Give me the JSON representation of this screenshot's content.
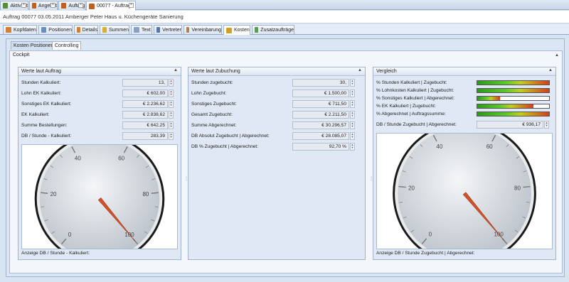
{
  "doc_tabs": [
    {
      "label": "Aktivität",
      "color": "#5a8a3c"
    },
    {
      "label": "Angebot",
      "color": "#c06020"
    },
    {
      "label": "Auftrag",
      "color": "#c06020"
    },
    {
      "label": "00077 - Auftrag",
      "color": "#c06020"
    }
  ],
  "header": {
    "title": "Auftrag 00077  03.05.2011  Amberger Peter Haus u. Küchengeräte  Sanierung"
  },
  "main_tabs": [
    {
      "label": "Kopfdaten"
    },
    {
      "label": "Positionen"
    },
    {
      "label": "Details"
    },
    {
      "label": "Summen"
    },
    {
      "label": "Text"
    },
    {
      "label": "Vertreter"
    },
    {
      "label": "Vereinbarung"
    },
    {
      "label": "Kosten"
    },
    {
      "label": "Zusatzaufträge"
    }
  ],
  "sub_tabs": [
    {
      "label": "Kosten Positionen"
    },
    {
      "label": "Controlling"
    }
  ],
  "cockpit": {
    "title": "Cockpit"
  },
  "panel_auftrag": {
    "title": "Werte laut Auftrag",
    "rows": [
      {
        "label": "Stunden Kalkuliert:",
        "value": "13,"
      },
      {
        "label": "Lohn EK Kalkuliert:",
        "value": "€ 602,00"
      },
      {
        "label": "Sonstiges EK Kalkuliert:",
        "value": "€ 2.236,62"
      },
      {
        "label": "EK Kalkuliert:",
        "value": "€ 2.838,62"
      },
      {
        "label": "Summe Bestellungen:",
        "value": "€ 642,25"
      },
      {
        "label": "DB / Stunde - Kalkuliert:",
        "value": "283,39"
      }
    ],
    "gauge_value": 100,
    "footer": "Anzeige DB / Stunde - Kalkuliert:"
  },
  "panel_zubuchung": {
    "title": "Werte laut Zubuchung",
    "rows": [
      {
        "label": "Stunden zugebucht:",
        "value": "30,"
      },
      {
        "label": "Lohn Zugebucht:",
        "value": "€ 1.500,00"
      },
      {
        "label": "Sonstiges Zugebucht:",
        "value": "€ 711,50"
      },
      {
        "label": "Gesamt Zugebucht:",
        "value": "€ 2.211,50"
      },
      {
        "label": "Summe Abgerechnet:",
        "value": "€ 30.296,57"
      },
      {
        "label": "DB Absolut  Zugebucht | Abgerechnet:",
        "value": "€ 28.085,07"
      },
      {
        "label": "DB % Zugebucht | Abgerechnet:",
        "value": "92,70 %"
      }
    ]
  },
  "panel_vergleich": {
    "title": "Vergleich",
    "bars": [
      {
        "label": "% Stunden Kalkuliert | Zugebucht:",
        "fill": 1.0
      },
      {
        "label": "% Lohnkosten Kalkuliert | Zugebucht:",
        "fill": 1.0
      },
      {
        "label": "% Sonstiges Kalkuliert | Abgerechnet:",
        "fill": 0.32
      },
      {
        "label": "%  EK Kalkuliert | Zugebucht:",
        "fill": 0.78
      },
      {
        "label": "% Abgerechnet | Auftragssumme:",
        "fill": 1.0
      }
    ],
    "db_label": "DB / Stunde Zugebucht | Abgerechnet:",
    "db_value": "€ 936,17",
    "gauge_value": 100,
    "footer": "Anzeige DB / Stunde Zugebucht | Abgerechnet:"
  },
  "gauge_ticks": [
    "0",
    "20",
    "40",
    "60",
    "80",
    "100"
  ],
  "colors": {
    "needle": "#d0502a",
    "accent": "#2a9a1c"
  }
}
